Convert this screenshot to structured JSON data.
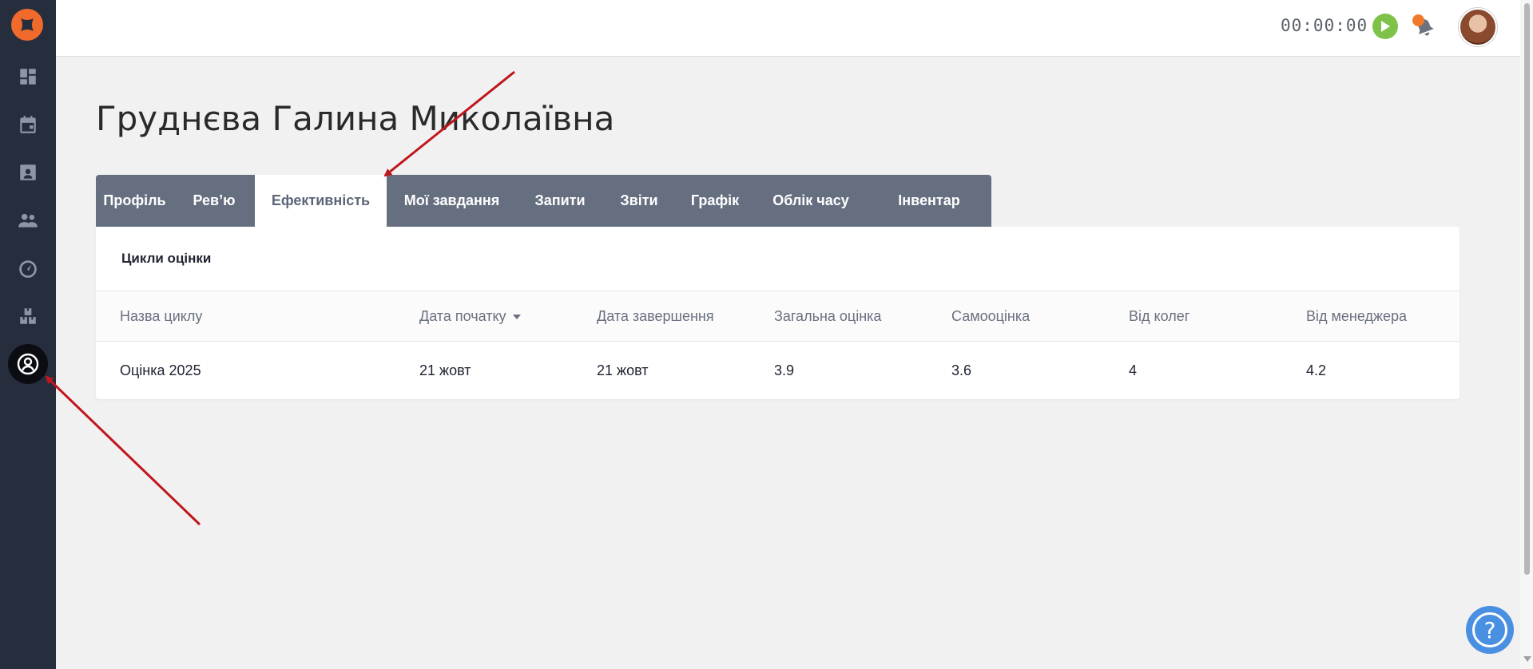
{
  "topbar": {
    "timer": "00:00:00"
  },
  "page": {
    "title": "Груднєва Галина Миколаївна"
  },
  "tabs": [
    {
      "label": "Профіль"
    },
    {
      "label": "Рев’ю"
    },
    {
      "label": "Ефективність"
    },
    {
      "label": "Мої завдання"
    },
    {
      "label": "Запити"
    },
    {
      "label": "Звіти"
    },
    {
      "label": "Графік"
    },
    {
      "label": "Облік часу"
    },
    {
      "label": "Інвентар"
    }
  ],
  "active_tab": "Ефективність",
  "card": {
    "title": "Цикли оцінки",
    "columns": [
      "Назва циклу",
      "Дата початку",
      "Дата завершення",
      "Загальна оцінка",
      "Самооцінка",
      "Від колег",
      "Від менеджера"
    ],
    "rows": [
      [
        "Оцінка 2025",
        "21 жовт",
        "21 жовт",
        "3.9",
        "3.6",
        "4",
        "4.2"
      ]
    ]
  },
  "help": {
    "label": "?"
  },
  "colors": {
    "sidebar": "#262d3d",
    "accent_orange": "#ef6a2b",
    "tab_bar": "#666f80",
    "play_green": "#7ec24a",
    "help_blue": "#4a90e2",
    "annotation_red": "#c0161c"
  }
}
